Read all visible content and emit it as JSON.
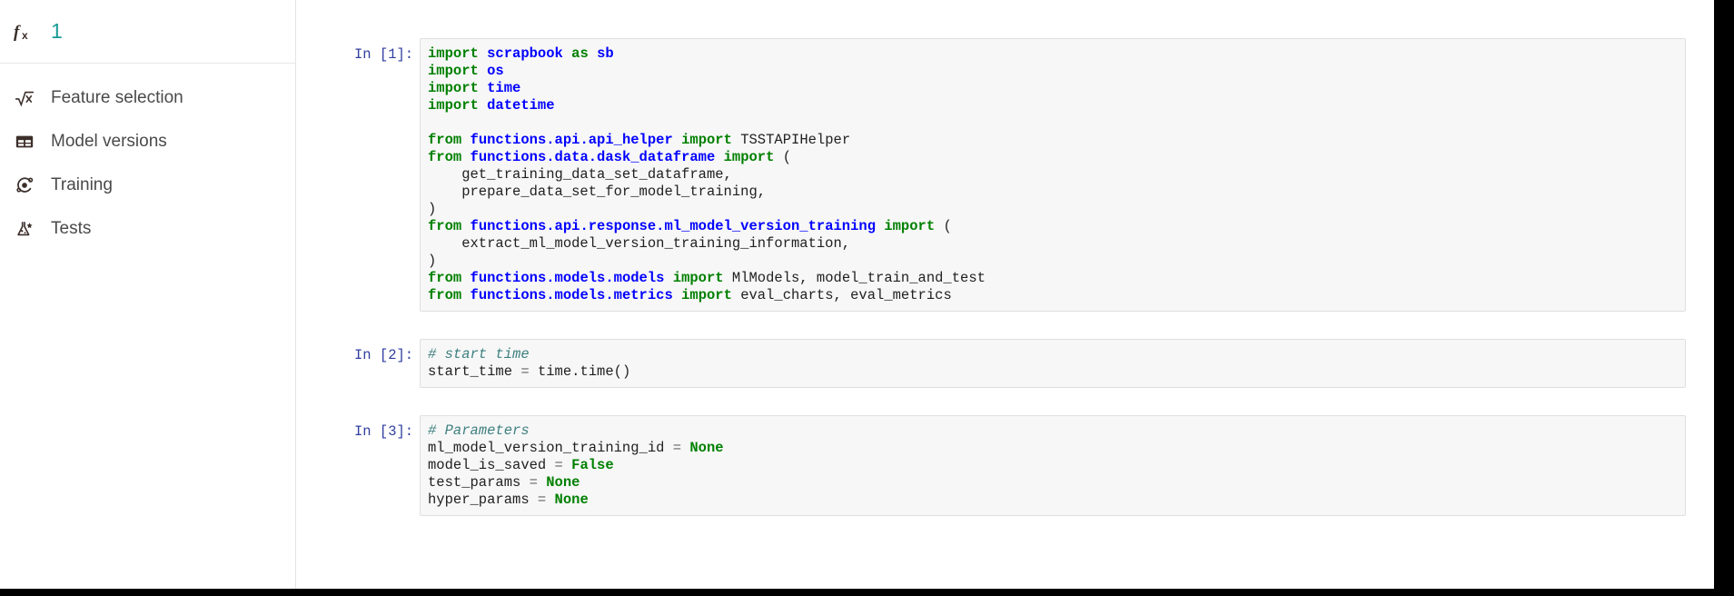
{
  "sidebar": {
    "header": {
      "icon": "function-fx-icon",
      "title": "1"
    },
    "items": [
      {
        "icon": "square-root-icon",
        "label": "Feature selection"
      },
      {
        "icon": "table-grid-icon",
        "label": "Model versions"
      },
      {
        "icon": "atom-orbit-icon",
        "label": "Training"
      },
      {
        "icon": "flask-test-icon",
        "label": "Tests"
      }
    ]
  },
  "notebook": {
    "cells": [
      {
        "prompt": "In [1]:",
        "lines": [
          [
            {
              "t": "import",
              "c": "k"
            },
            {
              "t": " ",
              "c": "n"
            },
            {
              "t": "scrapbook",
              "c": "nn"
            },
            {
              "t": " ",
              "c": "n"
            },
            {
              "t": "as",
              "c": "k"
            },
            {
              "t": " ",
              "c": "n"
            },
            {
              "t": "sb",
              "c": "nn"
            }
          ],
          [
            {
              "t": "import",
              "c": "k"
            },
            {
              "t": " ",
              "c": "n"
            },
            {
              "t": "os",
              "c": "nn"
            }
          ],
          [
            {
              "t": "import",
              "c": "k"
            },
            {
              "t": " ",
              "c": "n"
            },
            {
              "t": "time",
              "c": "nn"
            }
          ],
          [
            {
              "t": "import",
              "c": "k"
            },
            {
              "t": " ",
              "c": "n"
            },
            {
              "t": "datetime",
              "c": "nn"
            }
          ],
          [
            {
              "t": "",
              "c": "n"
            }
          ],
          [
            {
              "t": "from",
              "c": "k"
            },
            {
              "t": " ",
              "c": "n"
            },
            {
              "t": "functions.api.api_helper",
              "c": "nn"
            },
            {
              "t": " ",
              "c": "n"
            },
            {
              "t": "import",
              "c": "k"
            },
            {
              "t": " TSSTAPIHelper",
              "c": "n"
            }
          ],
          [
            {
              "t": "from",
              "c": "k"
            },
            {
              "t": " ",
              "c": "n"
            },
            {
              "t": "functions.data.dask_dataframe",
              "c": "nn"
            },
            {
              "t": " ",
              "c": "n"
            },
            {
              "t": "import",
              "c": "k"
            },
            {
              "t": " (",
              "c": "n"
            }
          ],
          [
            {
              "t": "    get_training_data_set_dataframe,",
              "c": "n"
            }
          ],
          [
            {
              "t": "    prepare_data_set_for_model_training,",
              "c": "n"
            }
          ],
          [
            {
              "t": ")",
              "c": "n"
            }
          ],
          [
            {
              "t": "from",
              "c": "k"
            },
            {
              "t": " ",
              "c": "n"
            },
            {
              "t": "functions.api.response.ml_model_version_training",
              "c": "nn"
            },
            {
              "t": " ",
              "c": "n"
            },
            {
              "t": "import",
              "c": "k"
            },
            {
              "t": " (",
              "c": "n"
            }
          ],
          [
            {
              "t": "    extract_ml_model_version_training_information,",
              "c": "n"
            }
          ],
          [
            {
              "t": ")",
              "c": "n"
            }
          ],
          [
            {
              "t": "from",
              "c": "k"
            },
            {
              "t": " ",
              "c": "n"
            },
            {
              "t": "functions.models.models",
              "c": "nn"
            },
            {
              "t": " ",
              "c": "n"
            },
            {
              "t": "import",
              "c": "k"
            },
            {
              "t": " MlModels, model_train_and_test",
              "c": "n"
            }
          ],
          [
            {
              "t": "from",
              "c": "k"
            },
            {
              "t": " ",
              "c": "n"
            },
            {
              "t": "functions.models.metrics",
              "c": "nn"
            },
            {
              "t": " ",
              "c": "n"
            },
            {
              "t": "import",
              "c": "k"
            },
            {
              "t": " eval_charts, eval_metrics",
              "c": "n"
            }
          ]
        ]
      },
      {
        "prompt": "In [2]:",
        "lines": [
          [
            {
              "t": "# start time",
              "c": "c"
            }
          ],
          [
            {
              "t": "start_time ",
              "c": "n"
            },
            {
              "t": "=",
              "c": "o"
            },
            {
              "t": " time.time()",
              "c": "n"
            }
          ]
        ]
      },
      {
        "prompt": "In [3]:",
        "lines": [
          [
            {
              "t": "# Parameters",
              "c": "c"
            }
          ],
          [
            {
              "t": "ml_model_version_training_id ",
              "c": "n"
            },
            {
              "t": "=",
              "c": "o"
            },
            {
              "t": " ",
              "c": "n"
            },
            {
              "t": "None",
              "c": "kc"
            }
          ],
          [
            {
              "t": "model_is_saved ",
              "c": "n"
            },
            {
              "t": "=",
              "c": "o"
            },
            {
              "t": " ",
              "c": "n"
            },
            {
              "t": "False",
              "c": "kc"
            }
          ],
          [
            {
              "t": "test_params ",
              "c": "n"
            },
            {
              "t": "=",
              "c": "o"
            },
            {
              "t": " ",
              "c": "n"
            },
            {
              "t": "None",
              "c": "kc"
            }
          ],
          [
            {
              "t": "hyper_params ",
              "c": "n"
            },
            {
              "t": "=",
              "c": "o"
            },
            {
              "t": " ",
              "c": "n"
            },
            {
              "t": "None",
              "c": "kc"
            }
          ]
        ]
      }
    ]
  },
  "colors": {
    "accent_teal": "#1a9a94",
    "prompt_blue": "#303f9f",
    "keyword_green": "#008000",
    "module_blue": "#0000ff",
    "comment_teal": "#408080",
    "cell_bg": "#f7f7f7",
    "cell_border": "#dfdfdf"
  }
}
